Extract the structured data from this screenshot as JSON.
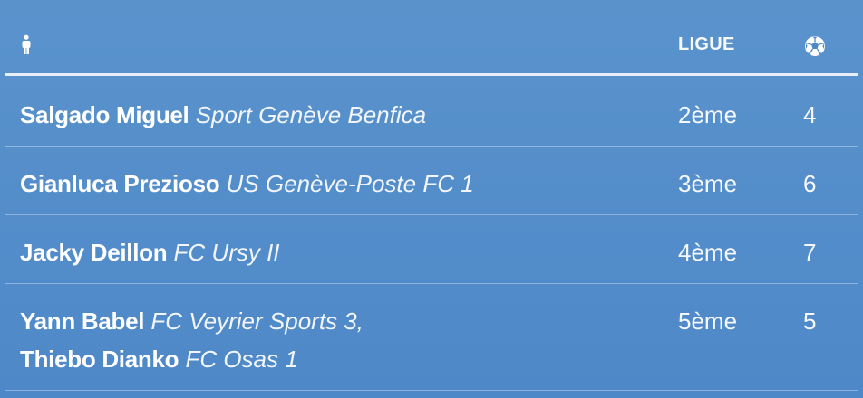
{
  "header": {
    "person_icon": "person-icon",
    "ligue_label": "LIGUE",
    "goals_icon": "soccer-ball-icon"
  },
  "rows": [
    {
      "players": [
        {
          "name": "Salgado Miguel",
          "club": "Sport Genève Benfica"
        }
      ],
      "league": "2ème",
      "goals": "4"
    },
    {
      "players": [
        {
          "name": "Gianluca Prezioso",
          "club": "US Genève-Poste FC 1"
        }
      ],
      "league": "3ème",
      "goals": "6"
    },
    {
      "players": [
        {
          "name": "Jacky Deillon",
          "club": "FC Ursy II"
        }
      ],
      "league": "4ème",
      "goals": "7"
    },
    {
      "players": [
        {
          "name": "Yann Babel",
          "club": "FC Veyrier Sports 3,"
        },
        {
          "name": "Thiebo Dianko",
          "club": "FC Osas 1"
        }
      ],
      "league": "5ème",
      "goals": "5"
    }
  ]
}
